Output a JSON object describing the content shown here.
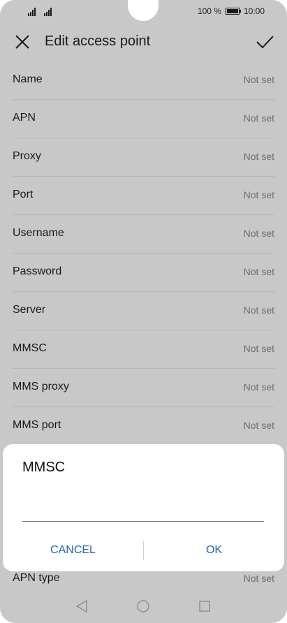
{
  "status_bar": {
    "battery_text": "100 %",
    "time": "10:00"
  },
  "toolbar": {
    "title": "Edit access point",
    "close_icon": "close-icon",
    "confirm_icon": "check-icon"
  },
  "fields": [
    {
      "label": "Name",
      "value": "Not set"
    },
    {
      "label": "APN",
      "value": "Not set"
    },
    {
      "label": "Proxy",
      "value": "Not set"
    },
    {
      "label": "Port",
      "value": "Not set"
    },
    {
      "label": "Username",
      "value": "Not set"
    },
    {
      "label": "Password",
      "value": "Not set"
    },
    {
      "label": "Server",
      "value": "Not set"
    },
    {
      "label": "MMSC",
      "value": "Not set"
    },
    {
      "label": "MMS proxy",
      "value": "Not set"
    },
    {
      "label": "MMS port",
      "value": "Not set"
    }
  ],
  "bottom_field": {
    "label": "APN type",
    "value": "Not set"
  },
  "dialog": {
    "title": "MMSC",
    "input_value": "",
    "cancel_label": "CANCEL",
    "ok_label": "OK"
  },
  "colors": {
    "accent": "#1e63b8",
    "overlay": "#c8c8c8"
  }
}
